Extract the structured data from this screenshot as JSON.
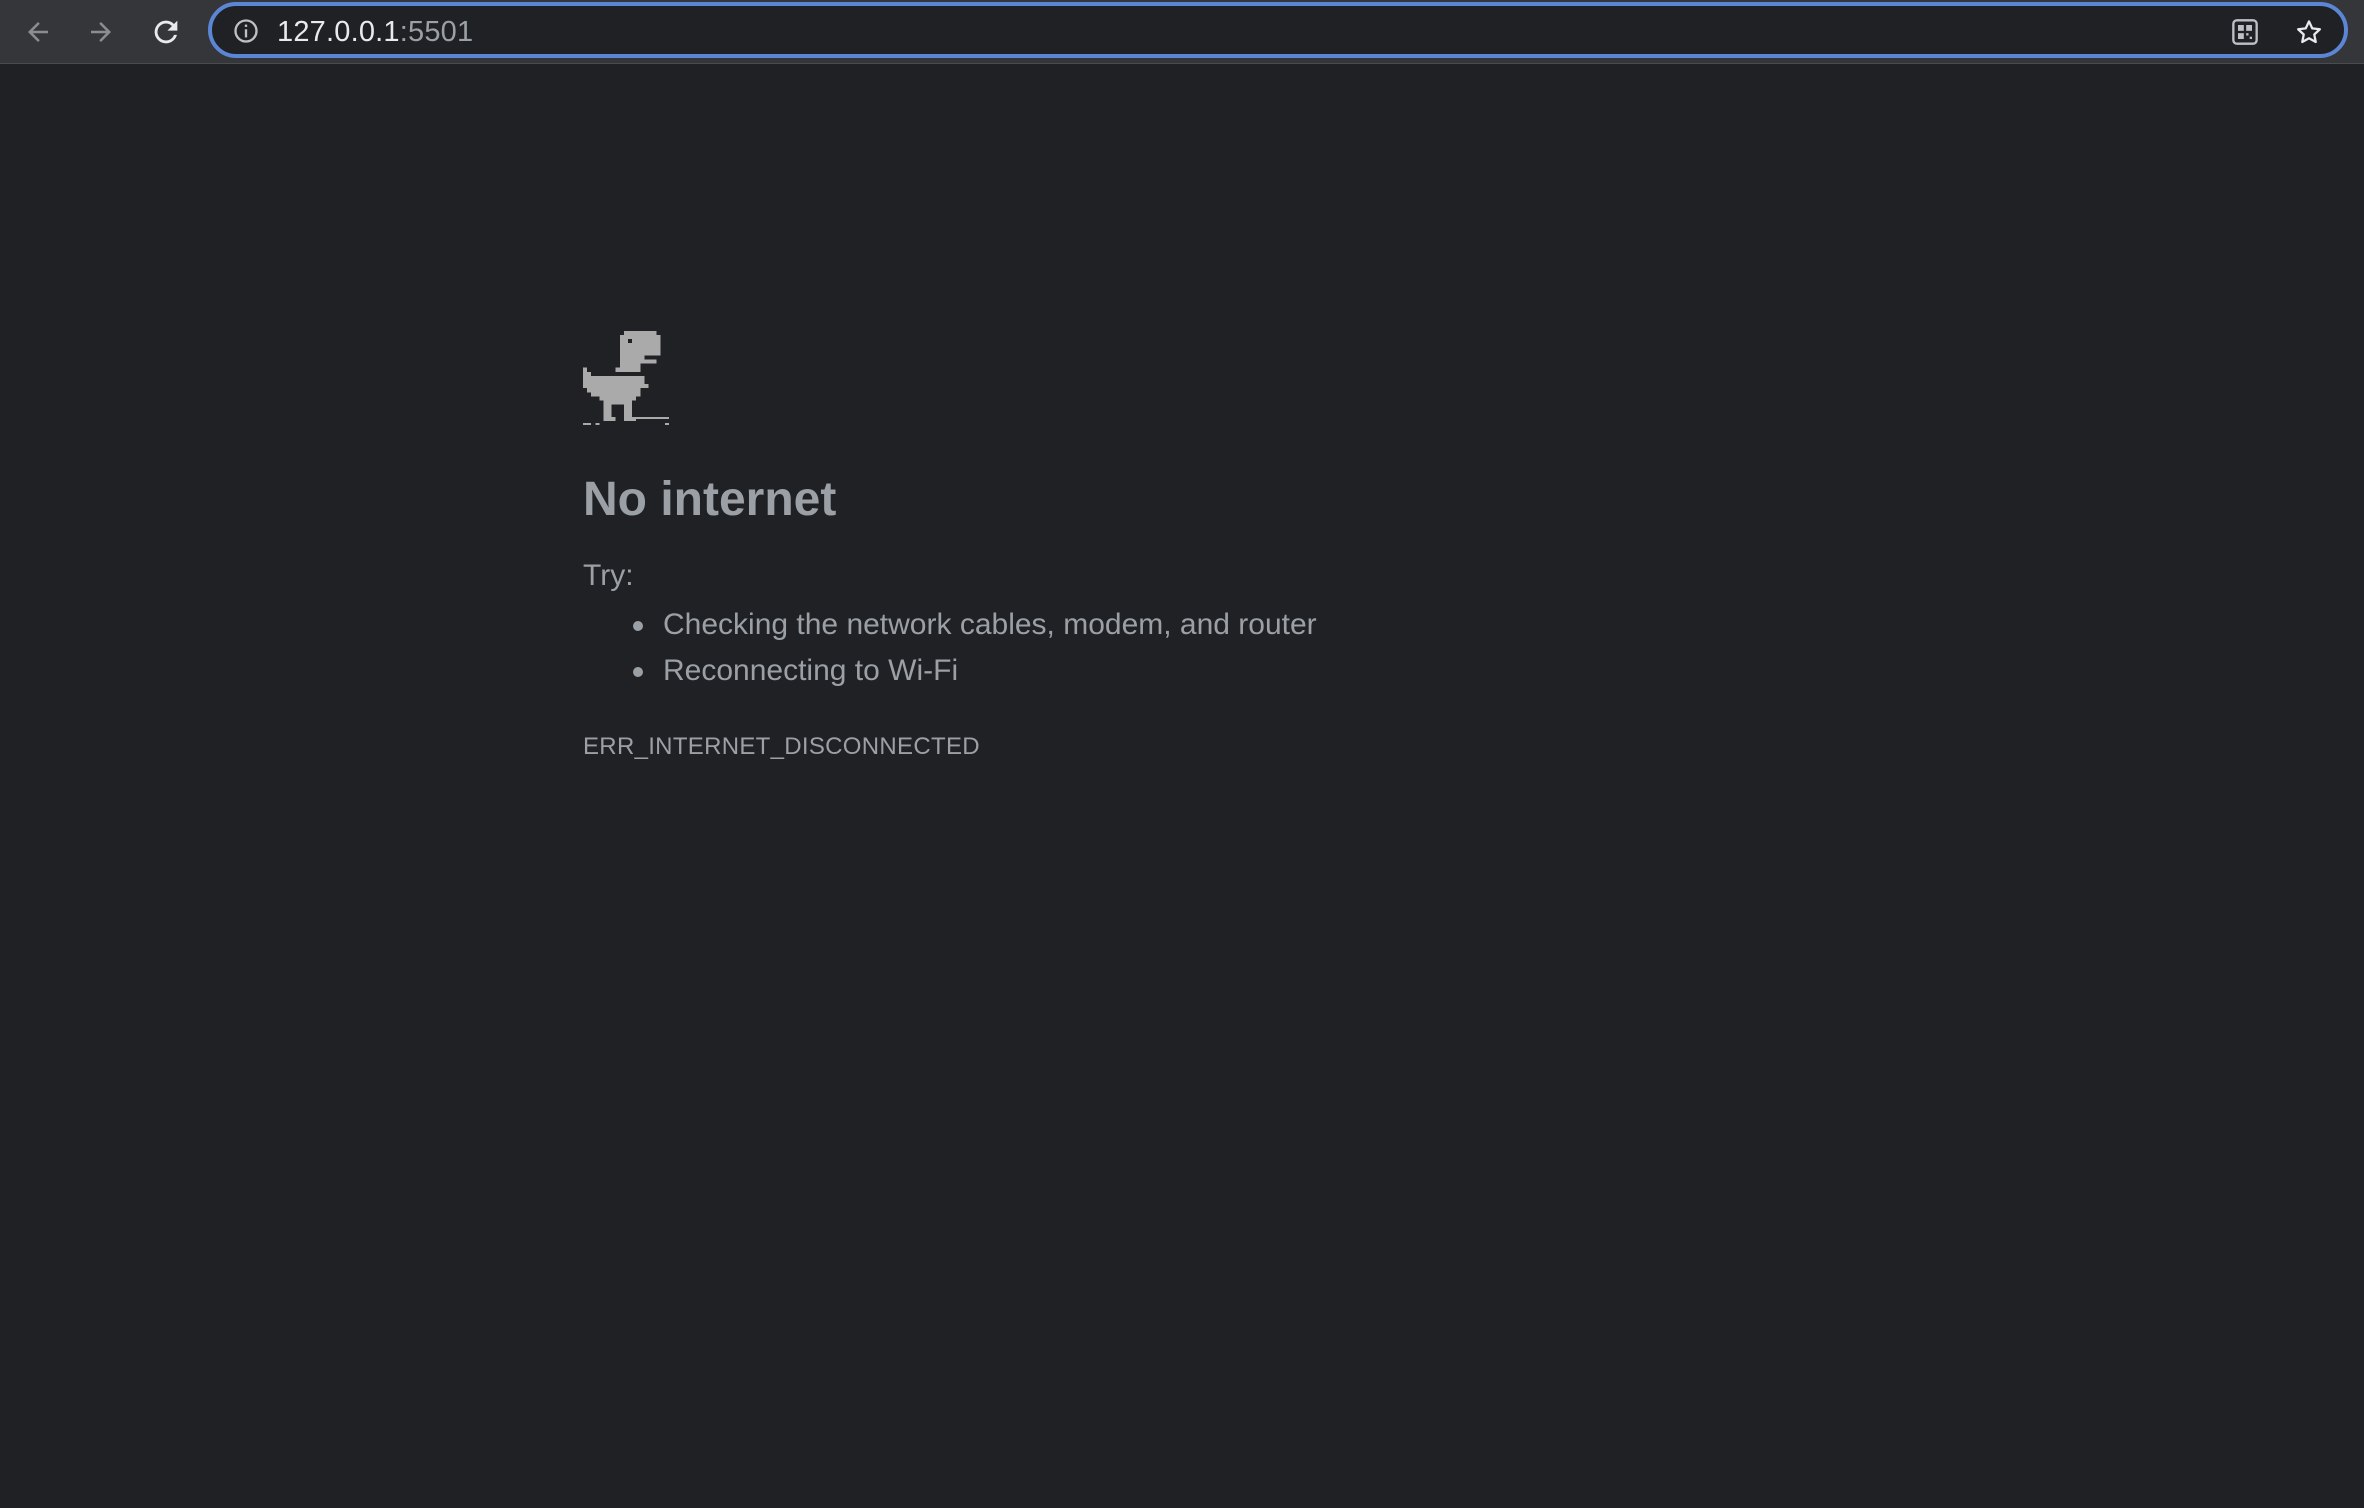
{
  "browser": {
    "nav": {
      "back_icon": "arrow-left-icon",
      "forward_icon": "arrow-right-icon",
      "reload_icon": "reload-icon"
    },
    "omnibox": {
      "site_info_icon": "info-circle-icon",
      "url_host": "127.0.0.1",
      "url_port": ":5501",
      "qr_icon": "qr-code-icon",
      "bookmark_icon": "star-icon",
      "focus_color": "#5b86d6"
    }
  },
  "page": {
    "illustration": "offline-dinosaur-icon",
    "title": "No internet",
    "try_label": "Try:",
    "suggestions": [
      "Checking the network cables, modem, and router",
      "Reconnecting to Wi-Fi"
    ],
    "error_code": "ERR_INTERNET_DISCONNECTED"
  },
  "colors": {
    "background": "#202124",
    "toolbar": "#35363a",
    "text": "#9aa0a6",
    "url_text": "#e8eaed"
  }
}
